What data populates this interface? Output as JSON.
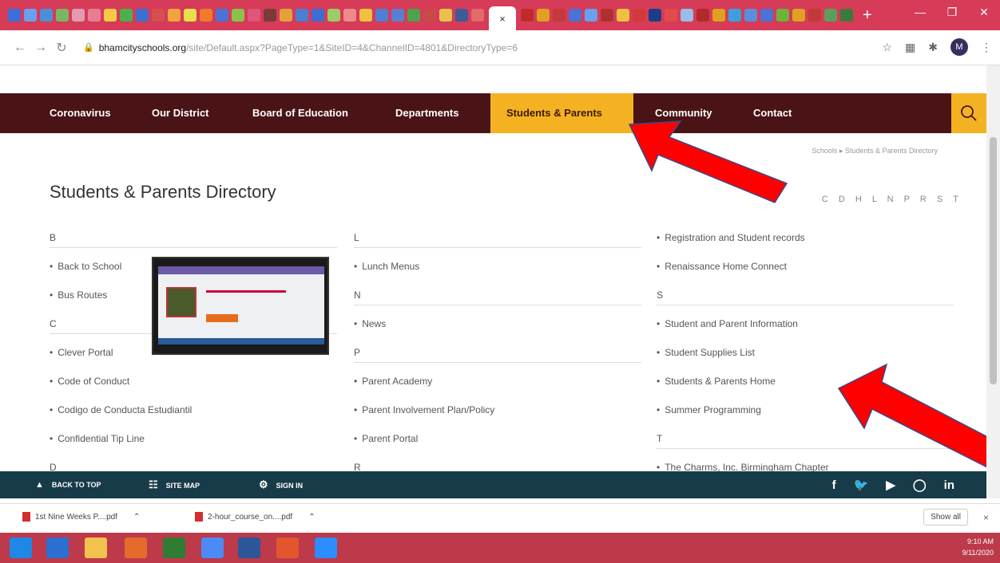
{
  "browser": {
    "active_tab_close": "×",
    "new_tab": "+",
    "address": {
      "host": "bhamcityschools.org",
      "path": "/site/Default.aspx?PageType=1&SiteID=4&ChannelID=4801&DirectoryType=6"
    },
    "profile_initial": "M"
  },
  "site_nav": {
    "items": [
      {
        "label": "Coronavirus"
      },
      {
        "label": "Our District"
      },
      {
        "label": "Board of Education"
      },
      {
        "label": "Departments"
      },
      {
        "label": "Students & Parents"
      },
      {
        "label": "Community"
      },
      {
        "label": "Contact"
      }
    ]
  },
  "breadcrumb": "Schools  ▸  Students & Parents Directory",
  "page_title": "Students & Parents Directory",
  "alphabet": [
    "C",
    "D",
    "H",
    "L",
    "N",
    "P",
    "R",
    "S",
    "T"
  ],
  "directory": {
    "col1": {
      "groups": [
        {
          "letter": "B",
          "items": [
            "Back to School",
            "Bus Routes"
          ]
        },
        {
          "letter": "C",
          "items": [
            "Clever Portal",
            "Code of Conduct",
            "Codigo de Conducta Estudiantil",
            "Confidential Tip Line"
          ]
        }
      ],
      "trailing_letter": "D"
    },
    "col2": {
      "groups": [
        {
          "letter": "L",
          "items": [
            "Lunch Menus"
          ]
        },
        {
          "letter": "N",
          "items": [
            "News"
          ]
        },
        {
          "letter": "P",
          "items": [
            "Parent Academy",
            "Parent Involvement Plan/Policy",
            "Parent Portal"
          ]
        }
      ],
      "trailing_letter": "R"
    },
    "col3": {
      "lead_items": [
        "Registration and Student records",
        "Renaissance Home Connect"
      ],
      "groups": [
        {
          "letter": "S",
          "items": [
            "Student and Parent Information",
            "Student Supplies List",
            "Students & Parents Home",
            "Summer Programming"
          ]
        },
        {
          "letter": "T",
          "items": [
            "The Charms, Inc. Birmingham Chapter"
          ]
        }
      ]
    }
  },
  "footer": {
    "back_to_top": "BACK TO TOP",
    "site_map": "SITE MAP",
    "sign_in": "SIGN IN",
    "social": [
      "f",
      "in"
    ]
  },
  "downloads": {
    "files": [
      "1st Nine Weeks P....pdf",
      "2-hour_course_on....pdf"
    ],
    "show_all": "Show all",
    "close": "×"
  },
  "taskbar": {
    "time": "9:10 AM",
    "date": "9/11/2020"
  },
  "colors": {
    "nav_bg": "#4a1416",
    "nav_active": "#f4b223",
    "footer_bg": "#183b4a",
    "arrow": "#ff0000"
  }
}
